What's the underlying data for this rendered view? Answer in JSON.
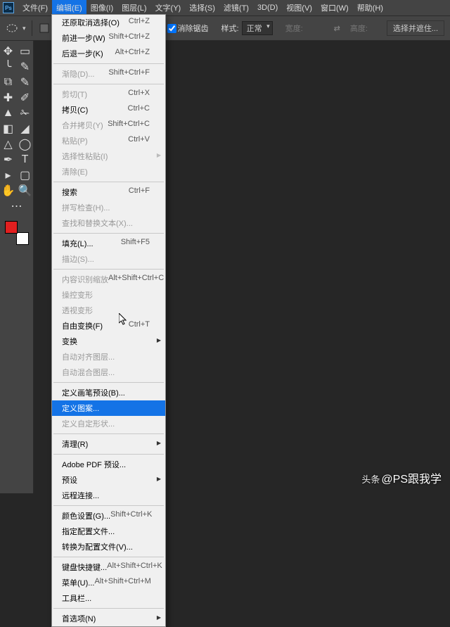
{
  "menubar": {
    "items": [
      "文件(F)",
      "编辑(E)",
      "图像(I)",
      "图层(L)",
      "文字(Y)",
      "选择(S)",
      "滤镜(T)",
      "3D(D)",
      "视图(V)",
      "窗口(W)",
      "帮助(H)"
    ],
    "activeIndex": 1
  },
  "optbar": {
    "antialias": "消除锯齿",
    "styleLabel": "样式:",
    "styleValue": "正常",
    "widthLabel": "宽度:",
    "heightLabel": "高度:",
    "selectMask": "选择并遮住..."
  },
  "editMenu": {
    "g1": [
      {
        "label": "还原取消选择(O)",
        "sc": "Ctrl+Z"
      },
      {
        "label": "前进一步(W)",
        "sc": "Shift+Ctrl+Z"
      },
      {
        "label": "后退一步(K)",
        "sc": "Alt+Ctrl+Z"
      }
    ],
    "g2": [
      {
        "label": "渐隐(D)...",
        "sc": "Shift+Ctrl+F",
        "dis": true
      }
    ],
    "g3": [
      {
        "label": "剪切(T)",
        "sc": "Ctrl+X",
        "dis": true
      },
      {
        "label": "拷贝(C)",
        "sc": "Ctrl+C"
      },
      {
        "label": "合并拷贝(Y)",
        "sc": "Shift+Ctrl+C",
        "dis": true
      },
      {
        "label": "粘贴(P)",
        "sc": "Ctrl+V",
        "dis": true
      },
      {
        "label": "选择性粘贴(I)",
        "arw": true,
        "dis": true
      },
      {
        "label": "清除(E)",
        "dis": true
      }
    ],
    "g4": [
      {
        "label": "搜索",
        "sc": "Ctrl+F"
      },
      {
        "label": "拼写检查(H)...",
        "dis": true
      },
      {
        "label": "查找和替换文本(X)...",
        "dis": true
      }
    ],
    "g5": [
      {
        "label": "填充(L)...",
        "sc": "Shift+F5"
      },
      {
        "label": "描边(S)...",
        "dis": true
      }
    ],
    "g6": [
      {
        "label": "内容识别缩放",
        "sc": "Alt+Shift+Ctrl+C",
        "dis": true
      },
      {
        "label": "操控变形",
        "dis": true
      },
      {
        "label": "透视变形",
        "dis": true
      },
      {
        "label": "自由变换(F)",
        "sc": "Ctrl+T"
      },
      {
        "label": "变换",
        "arw": true
      },
      {
        "label": "自动对齐图层...",
        "dis": true
      },
      {
        "label": "自动混合图层...",
        "dis": true
      }
    ],
    "g7": [
      {
        "label": "定义画笔预设(B)..."
      },
      {
        "label": "定义图案...",
        "hov": true
      },
      {
        "label": "定义自定形状...",
        "dis": true
      }
    ],
    "g8": [
      {
        "label": "清理(R)",
        "arw": true
      }
    ],
    "g9": [
      {
        "label": "Adobe PDF 预设..."
      },
      {
        "label": "预设",
        "arw": true
      },
      {
        "label": "远程连接..."
      }
    ],
    "g10": [
      {
        "label": "颜色设置(G)...",
        "sc": "Shift+Ctrl+K"
      },
      {
        "label": "指定配置文件..."
      },
      {
        "label": "转换为配置文件(V)..."
      }
    ],
    "g11": [
      {
        "label": "键盘快捷键...",
        "sc": "Alt+Shift+Ctrl+K"
      },
      {
        "label": "菜单(U)...",
        "sc": "Alt+Shift+Ctrl+M"
      },
      {
        "label": "工具栏..."
      }
    ],
    "g12": [
      {
        "label": "首选项(N)",
        "arw": true
      }
    ]
  },
  "watermark": {
    "prefix": "头条",
    "handle": "@PS跟我学"
  }
}
